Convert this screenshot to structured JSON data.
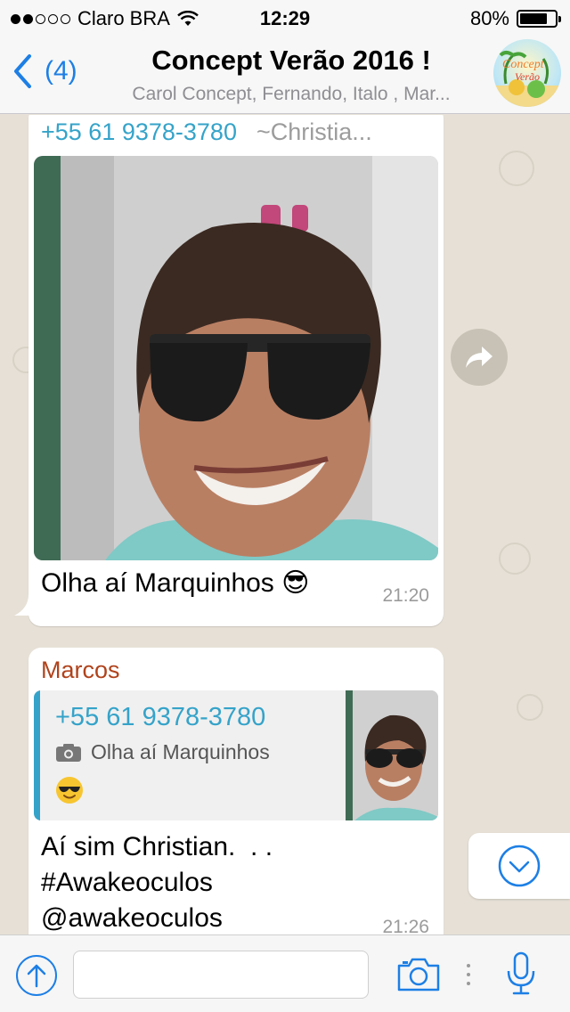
{
  "status_bar": {
    "carrier": "Claro BRA",
    "time": "12:29",
    "battery": "80%",
    "battery_level": 0.8,
    "signal_bars": 2
  },
  "nav": {
    "back_count": "(4)",
    "title": "Concept Verão 2016 !",
    "subtitle": "Carol Concept, Fernando, Italo , Mar..."
  },
  "messages": [
    {
      "sender_phone": "+55 61 9378-3780",
      "sender_alias": "~Christia...",
      "text": "Olha aí Marquinhos 😎",
      "time": "21:20"
    },
    {
      "sender_name": "Marcos",
      "quote_phone": "+55 61 9378-3780",
      "quote_text": "Olha aí Marquinhos",
      "quote_emoji": "😎",
      "text": "Aí sim Christian.  . .\n#Awakeoculos\n@awakeoculos",
      "time": "21:26"
    }
  ],
  "input": {
    "placeholder": ""
  },
  "icons": {
    "back": "chevron-left-icon",
    "forward": "share-arrow-icon",
    "scroll_down": "chevron-down-icon",
    "upload": "arrow-up-icon",
    "camera": "camera-icon",
    "mic": "microphone-icon"
  },
  "colors": {
    "accent": "#1d7fe5",
    "phone_name": "#35a3c9",
    "sender_marcos": "#b0431c"
  }
}
